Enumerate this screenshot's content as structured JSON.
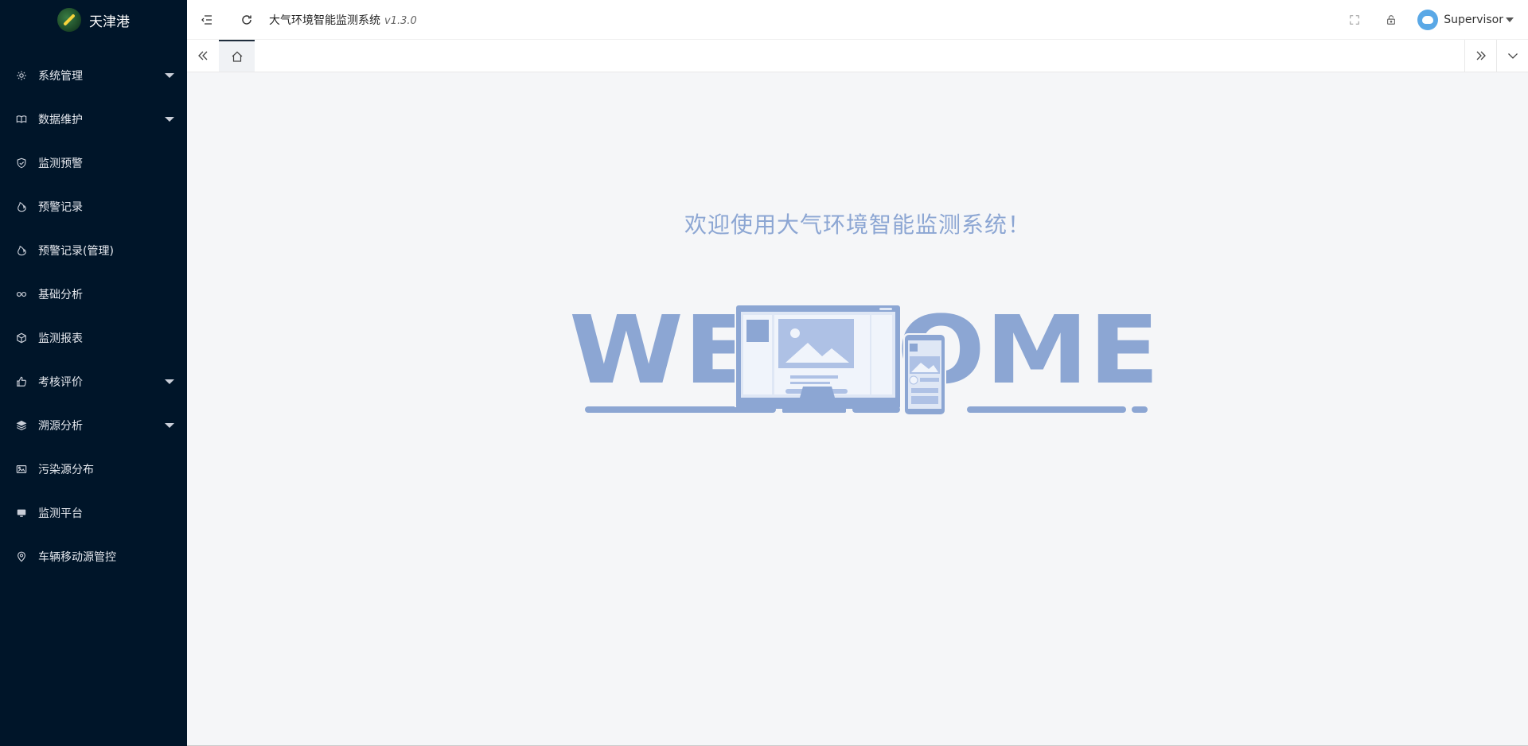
{
  "brand": {
    "name": "天津港",
    "logo_icon": "rocket-logo-icon"
  },
  "sidebar": {
    "items": [
      {
        "label": "系统管理",
        "icon": "gear-icon",
        "has_submenu": true
      },
      {
        "label": "数据维护",
        "icon": "book-icon",
        "has_submenu": true
      },
      {
        "label": "监测预警",
        "icon": "shield-check-icon",
        "has_submenu": false
      },
      {
        "label": "预警记录",
        "icon": "fire-icon",
        "has_submenu": false
      },
      {
        "label": "预警记录(管理)",
        "icon": "fire-icon",
        "has_submenu": false
      },
      {
        "label": "基础分析",
        "icon": "infinity-icon",
        "has_submenu": false
      },
      {
        "label": "监测报表",
        "icon": "cube-icon",
        "has_submenu": false
      },
      {
        "label": "考核评价",
        "icon": "thumbs-up-icon",
        "has_submenu": true
      },
      {
        "label": "溯源分析",
        "icon": "layers-icon",
        "has_submenu": true
      },
      {
        "label": "污染源分布",
        "icon": "image-icon",
        "has_submenu": false
      },
      {
        "label": "监测平台",
        "icon": "monitor-icon",
        "has_submenu": false
      },
      {
        "label": "车辆移动源管控",
        "icon": "location-pin-icon",
        "has_submenu": false
      }
    ]
  },
  "header": {
    "title": "大气环境智能监测系统",
    "version": "v1.3.0",
    "user_name": "Supervisor"
  },
  "main": {
    "welcome_message": "欢迎使用大气环境智能监测系统！",
    "illustration_text": "WELCOME"
  },
  "colors": {
    "sidebar_bg": "#001529",
    "content_bg": "#f5f6f8",
    "illustration": "#8ca6d3"
  }
}
